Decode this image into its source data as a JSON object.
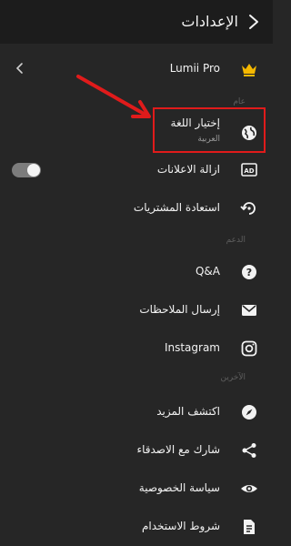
{
  "header": {
    "title": "الإعدادات"
  },
  "premium": {
    "label": "Lumii Pro"
  },
  "sections": {
    "general": "عام",
    "support": "الدعم",
    "other": "الآخرين"
  },
  "items": {
    "language": {
      "label": "إختيار اللغة",
      "value": "العربية"
    },
    "remove_ads": {
      "label": "ازالة الاعلانات",
      "toggle_on": true
    },
    "restore": {
      "label": "استعادة المشتريات"
    },
    "qa": {
      "label": "Q&A"
    },
    "feedback": {
      "label": "إرسال الملاحظات"
    },
    "instagram": {
      "label": "Instagram"
    },
    "discover": {
      "label": "اكتشف المزيد"
    },
    "share": {
      "label": "شارك مع الاصدقاء"
    },
    "privacy": {
      "label": "سياسة الخصوصية"
    },
    "terms": {
      "label": "شروط الاستخدام"
    }
  },
  "annotation": {
    "highlight_color": "#e01b1b"
  },
  "icons": {
    "back": "back-arrow-icon",
    "crown": "crown-icon",
    "globe": "globe-icon",
    "ad": "ad-icon",
    "restore": "restore-icon",
    "qa": "help-circle-icon",
    "mail": "mail-icon",
    "instagram": "instagram-icon",
    "compass": "compass-icon",
    "share": "share-icon",
    "eye": "eye-icon",
    "document": "document-icon"
  }
}
